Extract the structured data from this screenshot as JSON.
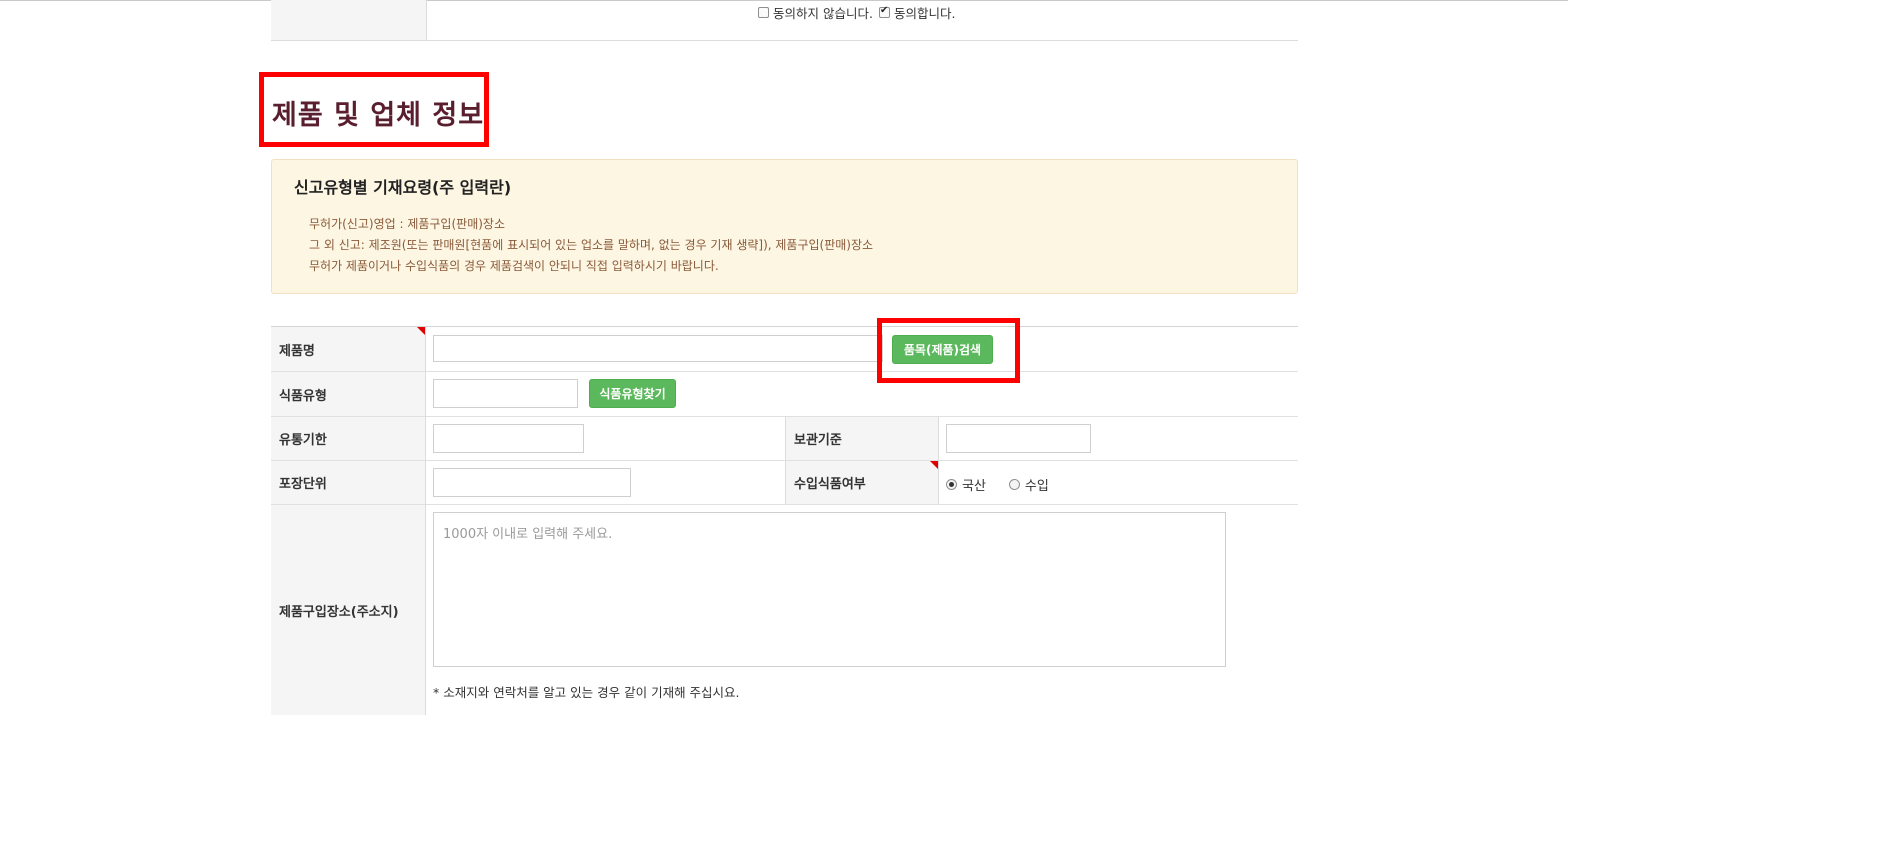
{
  "consent": {
    "disagree_label": "동의하지 않습니다.",
    "agree_label": "동의합니다."
  },
  "section": {
    "title": "제품 및 업체 정보"
  },
  "notice": {
    "heading": "신고유형별 기재요령(주 입력란)",
    "lines": [
      "무허가(신고)영업 : 제품구입(판매)장소",
      "그 외 신고: 제조원(또는 판매원[현품에 표시되어 있는 업소를 말하며, 없는 경우 기재 생략]), 제품구입(판매)장소",
      "무허가 제품이거나 수입식품의 경우 제품검색이 안되니 직접 입력하시기 바랍니다."
    ]
  },
  "form": {
    "product_name_label": "제품명",
    "product_search_button": "품목(제품)검색",
    "food_type_label": "식품유형",
    "food_type_button": "식품유형찾기",
    "expiry_label": "유통기한",
    "storage_label": "보관기준",
    "packaging_label": "포장단위",
    "import_label": "수입식품여부",
    "import_options": [
      "국산",
      "수입"
    ],
    "import_selected": "국산",
    "purchase_place_label": "제품구입장소(주소지)",
    "purchase_place_placeholder": "1000자 이내로 입력해 주세요.",
    "purchase_place_hint": "* 소재지와 연락처를 알고 있는 경우 같이 기재해 주십시요."
  }
}
